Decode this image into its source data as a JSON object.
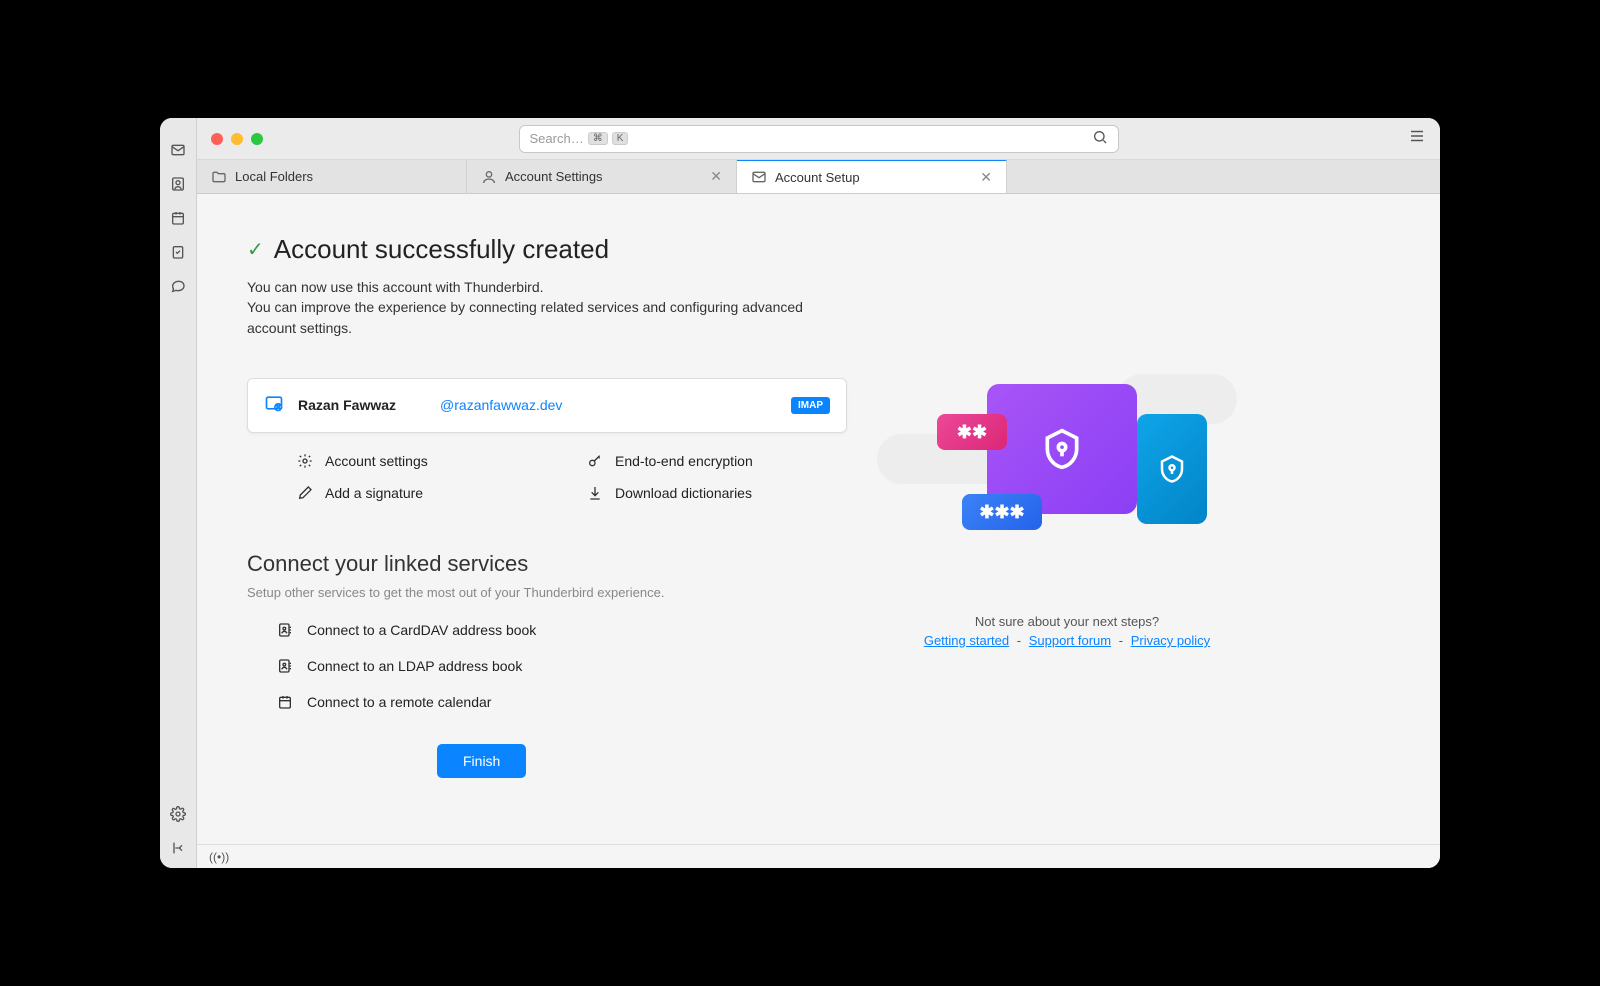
{
  "search": {
    "placeholder": "Search…",
    "kbd1": "⌘",
    "kbd2": "K"
  },
  "tabs": {
    "folders": "Local Folders",
    "settings": "Account Settings",
    "setup": "Account Setup"
  },
  "title": "Account successfully created",
  "subtitle1": "You can now use this account with Thunderbird.",
  "subtitle2": "You can improve the experience by connecting related services and configuring advanced account settings.",
  "account": {
    "name": "Razan Fawwaz",
    "email": "@razanfawwaz.dev",
    "protocol": "IMAP"
  },
  "actions": {
    "settings": "Account settings",
    "encryption": "End-to-end encryption",
    "signature": "Add a signature",
    "dictionaries": "Download dictionaries"
  },
  "linked": {
    "title": "Connect your linked services",
    "sub": "Setup other services to get the most out of your Thunderbird experience.",
    "carddav": "Connect to a CardDAV address book",
    "ldap": "Connect to an LDAP address book",
    "calendar": "Connect to a remote calendar"
  },
  "finish": "Finish",
  "help": {
    "prompt": "Not sure about your next steps?",
    "getting_started": "Getting started",
    "support": "Support forum",
    "privacy": "Privacy policy",
    "sep": "-"
  },
  "illus": {
    "asterisks2": "✱✱",
    "asterisks3": "✱✱✱"
  }
}
